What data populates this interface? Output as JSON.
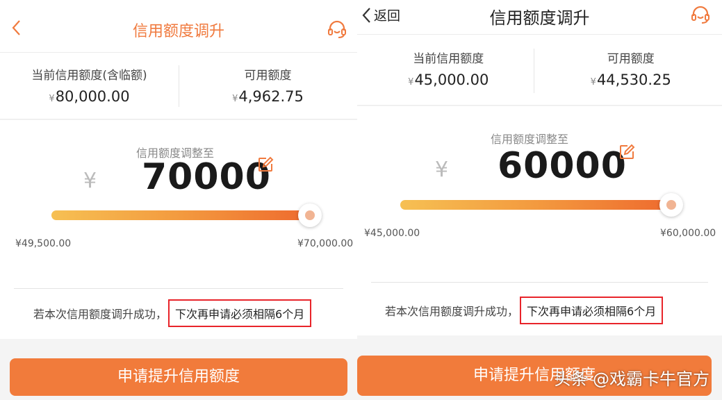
{
  "left": {
    "header": {
      "title": "信用额度调升",
      "back_icon": "chevron-left-icon",
      "service_icon": "headset-icon"
    },
    "info": {
      "current_label": "当前信用额度(含临额)",
      "current_value": "80,000.00",
      "available_label": "可用额度",
      "available_value": "4,962.75"
    },
    "adjust": {
      "label": "信用额度调整至",
      "currency": "¥",
      "amount": "70000",
      "min_label": "¥49,500.00",
      "max_label": "¥70,000.00",
      "slider_level": 1.0
    },
    "notice": {
      "text": "若本次信用额度调升成功，",
      "highlight": "下次再申请必须相隔6个月"
    },
    "cta": "申请提升信用额度"
  },
  "right": {
    "header": {
      "back_label": "返回",
      "title": "信用额度调升",
      "back_icon": "chevron-left-icon",
      "service_icon": "headset-icon"
    },
    "info": {
      "current_label": "当前信用额度",
      "current_value": "45,000.00",
      "available_label": "可用额度",
      "available_value": "44,530.25"
    },
    "adjust": {
      "label": "信用额度调整至",
      "currency": "¥",
      "amount": "60000",
      "min_label": "¥45,000.00",
      "max_label": "¥60,000.00",
      "slider_level": 1.0
    },
    "notice": {
      "text": "若本次信用额度调升成功，",
      "highlight": "下次再申请必须相隔6个月"
    },
    "cta": "申请提升信用额度",
    "watermark": "头条 @戏霸卡牛官方"
  },
  "colors": {
    "accent": "#f17b3b",
    "highlight_border": "#e8242a"
  },
  "yen_small": "¥"
}
